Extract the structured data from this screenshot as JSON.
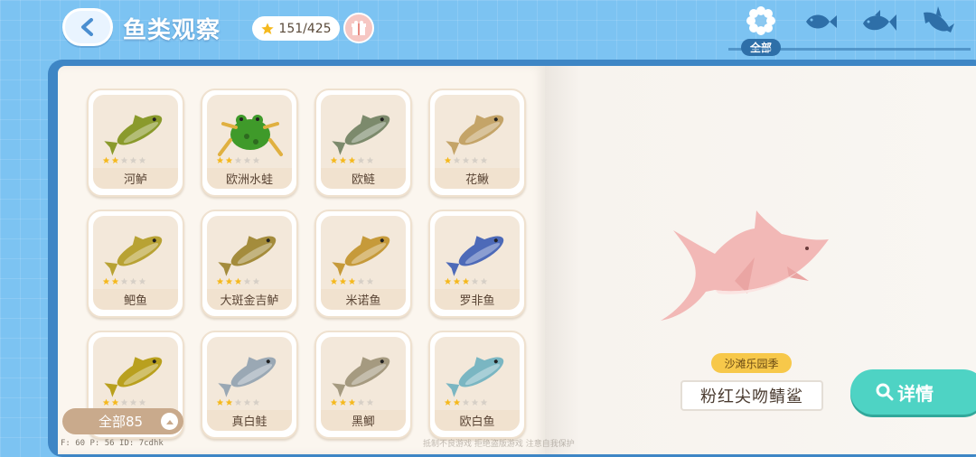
{
  "header": {
    "title": "鱼类观察",
    "star_count": "151/425"
  },
  "filters": {
    "all_label": "全部",
    "items": [
      {
        "name": "all-filter",
        "icon": "flower-icon"
      },
      {
        "name": "small-fish-filter",
        "icon": "small-fish-icon"
      },
      {
        "name": "medium-fish-filter",
        "icon": "medium-fish-icon"
      },
      {
        "name": "shark-filter",
        "icon": "shark-icon"
      }
    ]
  },
  "fish_cards": [
    {
      "name": "河鲈",
      "stars": 2,
      "color": "#8a9a2c"
    },
    {
      "name": "欧洲水蛙",
      "stars": 2,
      "color": "#3f9a2a"
    },
    {
      "name": "欧鲢",
      "stars": 3,
      "color": "#7c8a6c"
    },
    {
      "name": "花鳅",
      "stars": 1,
      "color": "#c4a468"
    },
    {
      "name": "鲃鱼",
      "stars": 2,
      "color": "#b8a234"
    },
    {
      "name": "大斑金吉鲈",
      "stars": 3,
      "color": "#a48c3c"
    },
    {
      "name": "米诺鱼",
      "stars": 3,
      "color": "#c69a3a"
    },
    {
      "name": "罗非鱼",
      "stars": 3,
      "color": "#4d6ab8"
    },
    {
      "name": "",
      "stars": 2,
      "color": "#b9a01e"
    },
    {
      "name": "真白鲑",
      "stars": 2,
      "color": "#9aa8b4"
    },
    {
      "name": "黑鲫",
      "stars": 3,
      "color": "#a59a80"
    },
    {
      "name": "欧白鱼",
      "stars": 2,
      "color": "#7ab6c2"
    }
  ],
  "collection_filter": {
    "label": "全部85"
  },
  "selected": {
    "season": "沙滩乐园季",
    "name": "粉红尖吻鲭鲨",
    "detail_label": "详情"
  },
  "debug": {
    "text": "F: 60  P: 56  ID: 7cdhk"
  },
  "watermark": {
    "text": "抵制不良游戏 拒绝盗版游戏 注意自我保护"
  },
  "colors": {
    "accent": "#4ed3c4",
    "book": "#3e86c5",
    "background": "#7cc3f2",
    "star": "#f5b91e"
  }
}
